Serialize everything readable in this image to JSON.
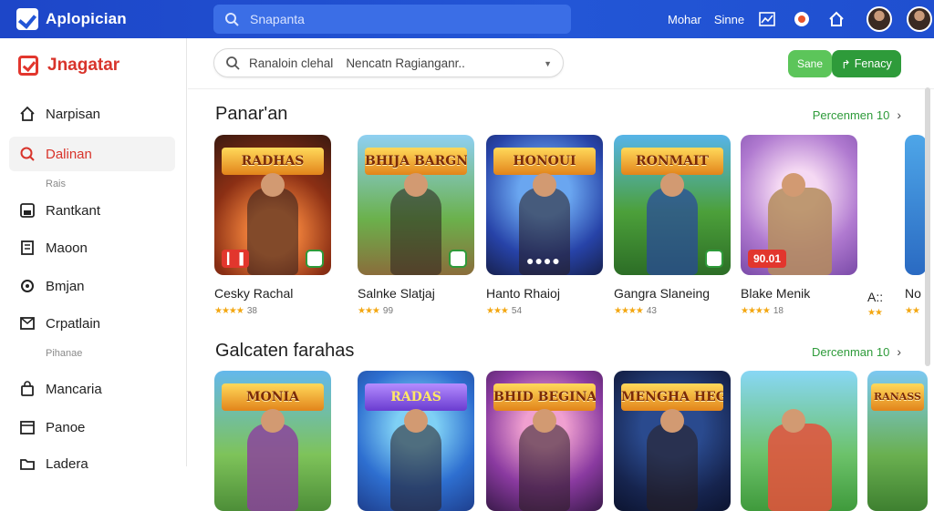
{
  "topbar": {
    "brand": "Aplopician",
    "search_placeholder": "Snapanta",
    "links": [
      "Mohar",
      "Sinne"
    ],
    "icons": [
      "chart-icon",
      "notification-icon",
      "home-icon",
      "user-avatar",
      "user-avatar"
    ]
  },
  "sidebar": {
    "brand": "Jnagatar",
    "items": [
      {
        "label": "Narpisan",
        "icon": "home-icon"
      },
      {
        "label": "Dalinan",
        "icon": "search-icon",
        "active": true
      },
      {
        "label": "Rantkant",
        "icon": "save-icon"
      },
      {
        "label": "Maoon",
        "icon": "document-icon"
      },
      {
        "label": "Bmjan",
        "icon": "gear-icon"
      },
      {
        "label": "Crpatlain",
        "icon": "library-icon"
      },
      {
        "label": "Mancaria",
        "icon": "bag-icon"
      },
      {
        "label": "Panoe",
        "icon": "calendar-icon"
      },
      {
        "label": "Ladera",
        "icon": "folder-icon"
      }
    ],
    "subs": [
      "Rais",
      "Pihanae"
    ]
  },
  "main": {
    "search_query_1": "Ranaloin clehal",
    "search_query_2": "Nencatn Ragianganr..",
    "btn_small": "Sane",
    "btn_primary": "Fenacy",
    "sections": [
      {
        "title": "Panar'an",
        "see_more": "Percenmen 10",
        "cards": [
          {
            "title": "Cesky Rachal",
            "rating": "38",
            "logo": "RADHAS",
            "badge_left": "▎▐"
          },
          {
            "title": "Salnke Slatjaj",
            "rating": "99",
            "logo": "BHIJA BARGNES",
            "badge_left": ""
          },
          {
            "title": "Hanto Rhaioj",
            "rating": "54",
            "logo": "HONOUI",
            "badge_left": ""
          },
          {
            "title": "Gangra Slaneing",
            "rating": "43",
            "logo": "RONMAIT",
            "badge_left": ""
          },
          {
            "title": "Blake Menik",
            "rating": "18",
            "logo": "",
            "badge_left": "90.01"
          },
          {
            "title": "A::",
            "rating": "",
            "logo": "",
            "badge_left": ""
          },
          {
            "title": "No",
            "rating": "",
            "logo": "",
            "badge_left": ""
          }
        ]
      },
      {
        "title": "Galcaten farahas",
        "see_more": "Dercenman 10",
        "cards": [
          {
            "logo": "MONIA"
          },
          {
            "logo": "RADAS"
          },
          {
            "logo": "BHID BEGINAS"
          },
          {
            "logo": "MENGHA HEGHALER"
          },
          {
            "logo": ""
          },
          {
            "logo": "RANASS"
          }
        ]
      }
    ]
  },
  "colors": {
    "topbar": "#2356d6",
    "accent_red": "#d8342b",
    "accent_green": "#2e9b3a",
    "star": "#f3a712"
  }
}
